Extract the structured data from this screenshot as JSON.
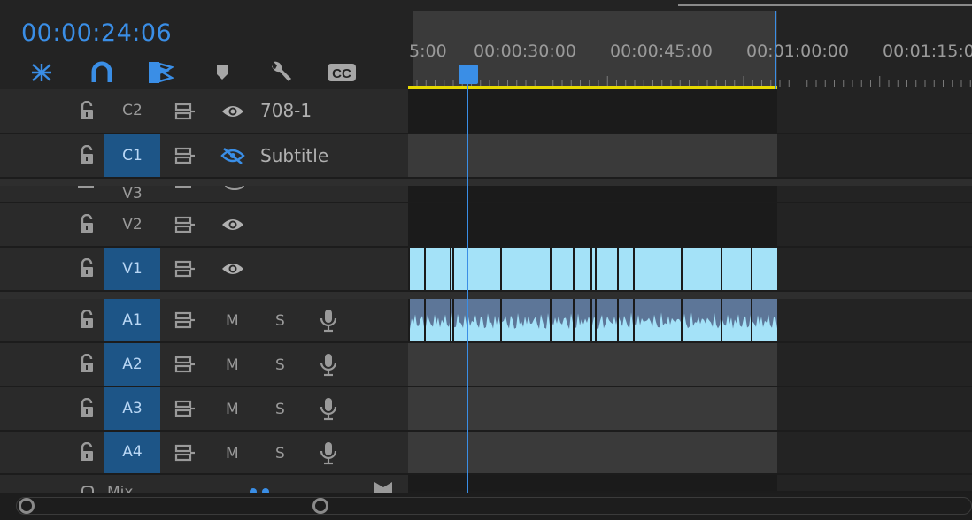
{
  "header": {
    "timecode": "00:00:24:06",
    "tools": [
      {
        "name": "snap-in-timeline-icon"
      },
      {
        "name": "magnet-icon"
      },
      {
        "name": "linked-selection-icon"
      },
      {
        "name": "add-marker-icon"
      },
      {
        "name": "wrench-icon"
      },
      {
        "name": "captions-icon",
        "text": "CC"
      }
    ]
  },
  "ruler": {
    "labels": [
      "5:00",
      "00:00:30:00",
      "00:00:45:00",
      "00:01:00:00",
      "00:01:15:0"
    ]
  },
  "tracks": {
    "captions": [
      {
        "name": "C2",
        "label": "708-1",
        "selected": false,
        "visible": true
      },
      {
        "name": "C1",
        "label": "Subtitle",
        "selected": true,
        "visible": false
      }
    ],
    "video": [
      {
        "name": "V3"
      },
      {
        "name": "V2",
        "selected": false
      },
      {
        "name": "V1",
        "selected": true
      }
    ],
    "audio": [
      {
        "name": "A1",
        "mute": "M",
        "solo": "S"
      },
      {
        "name": "A2",
        "mute": "M",
        "solo": "S"
      },
      {
        "name": "A3",
        "mute": "M",
        "solo": "S"
      },
      {
        "name": "A4",
        "mute": "M",
        "solo": "S"
      }
    ],
    "mix_label": "Mix"
  },
  "colors": {
    "accent": "#3a8ee6",
    "selected_track": "#1d5587",
    "video_clip": "#a4e2f8",
    "audio_clip": "#5d7698",
    "work_area_bar": "#e6d800"
  }
}
